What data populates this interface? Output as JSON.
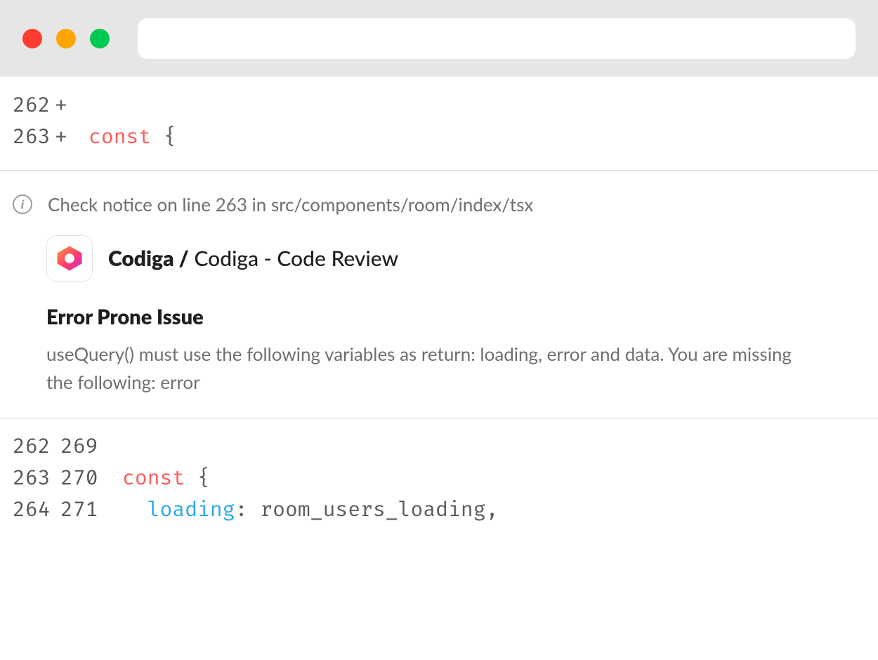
{
  "top_diff": {
    "lines": [
      {
        "left": "262",
        "right": "+",
        "keyword": "",
        "rest": ""
      },
      {
        "left": "263",
        "right": "+",
        "keyword": "const",
        "rest": " {"
      }
    ]
  },
  "notice": {
    "text": "Check notice on line 263 in src/components/room/index/tsx"
  },
  "review": {
    "app_bold": "Codiga /",
    "app_rest": " Codiga - Code Review",
    "issue_title": "Error Prone Issue",
    "issue_desc": "useQuery() must use the following variables as return: loading, error and data. You are missing the following: error"
  },
  "bottom_diff": {
    "lines": [
      {
        "left": "262",
        "right": "269",
        "indent": "",
        "keyword": "",
        "rest": ""
      },
      {
        "left": "263",
        "right": "270",
        "indent": "",
        "keyword": "const",
        "rest": " {"
      },
      {
        "left": "264",
        "right": "271",
        "indent": "  ",
        "prop": "loading",
        "rest": ": room_users_loading,"
      }
    ]
  }
}
